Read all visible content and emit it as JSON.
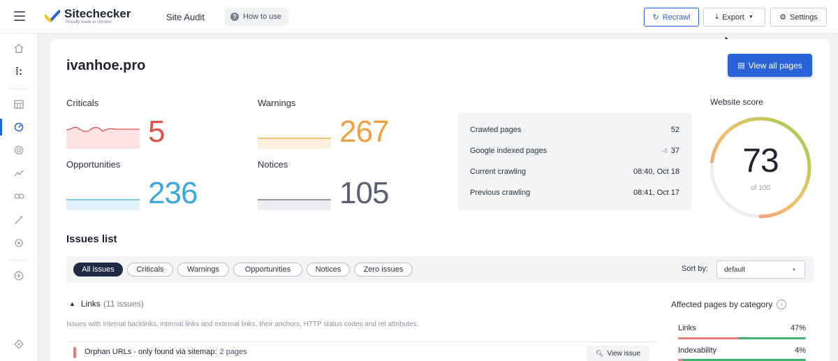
{
  "app": {
    "brand": "Sitechecker",
    "tagline": "Proudly made in Ukraine",
    "section": "Site Audit",
    "how_to_use": "How to use"
  },
  "toolbar": {
    "recrawl": "Recrawl",
    "export": "Export",
    "settings": "Settings"
  },
  "sidebar": {
    "icons": [
      "home-icon",
      "dashboard-icon",
      "table-icon",
      "gauge-icon",
      "target-icon",
      "trend-icon",
      "link-icon",
      "magic-wand-icon",
      "crosshair-icon",
      "plus-circle-icon",
      "diamond-icon"
    ],
    "active": "gauge-icon"
  },
  "site": {
    "domain": "ivanhoe.pro",
    "view_all": "View all pages"
  },
  "stats": {
    "criticals": {
      "label": "Criticals",
      "value": "5",
      "color": "#e0504a"
    },
    "warnings": {
      "label": "Warnings",
      "value": "267",
      "color": "#f0a040"
    },
    "opportunities": {
      "label": "Opportunities",
      "value": "236",
      "color": "#3aa8dc"
    },
    "notices": {
      "label": "Notices",
      "value": "105",
      "color": "#5a6070"
    }
  },
  "crawl": {
    "rows": [
      {
        "label": "Crawled pages",
        "value": "52",
        "trend": ""
      },
      {
        "label": "Google indexed pages",
        "value": "37",
        "trend": "-4"
      },
      {
        "label": "Current crawling",
        "value": "08:40, Oct 18",
        "trend": ""
      },
      {
        "label": "Previous crawling",
        "value": "08:41, Oct 17",
        "trend": ""
      }
    ]
  },
  "score": {
    "label": "Website score",
    "value": "73",
    "of": "of 100",
    "fraction": 0.73
  },
  "issues": {
    "title": "Issues list",
    "filters": [
      "All issues",
      "Criticals",
      "Warnings",
      "Opportunities",
      "Notices",
      "Zero issues"
    ],
    "active_filter": "All issues",
    "sort_label": "Sort by:",
    "sort_value": "default",
    "group": {
      "name": "Links",
      "count": "(11 issues)",
      "description": "Issues with internal backlinks, internal links and external links, their anchors, HTTP status codes and rel attributes."
    },
    "rows": [
      {
        "title": "Orphan URLs - only found via sitemap:",
        "pages": "2 pages",
        "action": "View issue"
      }
    ]
  },
  "affected": {
    "title": "Affected pages by category",
    "categories": [
      {
        "name": "Links",
        "percent": "47%",
        "fraction": 0.47
      },
      {
        "name": "Indexability",
        "percent": "4%",
        "fraction": 0.04
      }
    ]
  }
}
